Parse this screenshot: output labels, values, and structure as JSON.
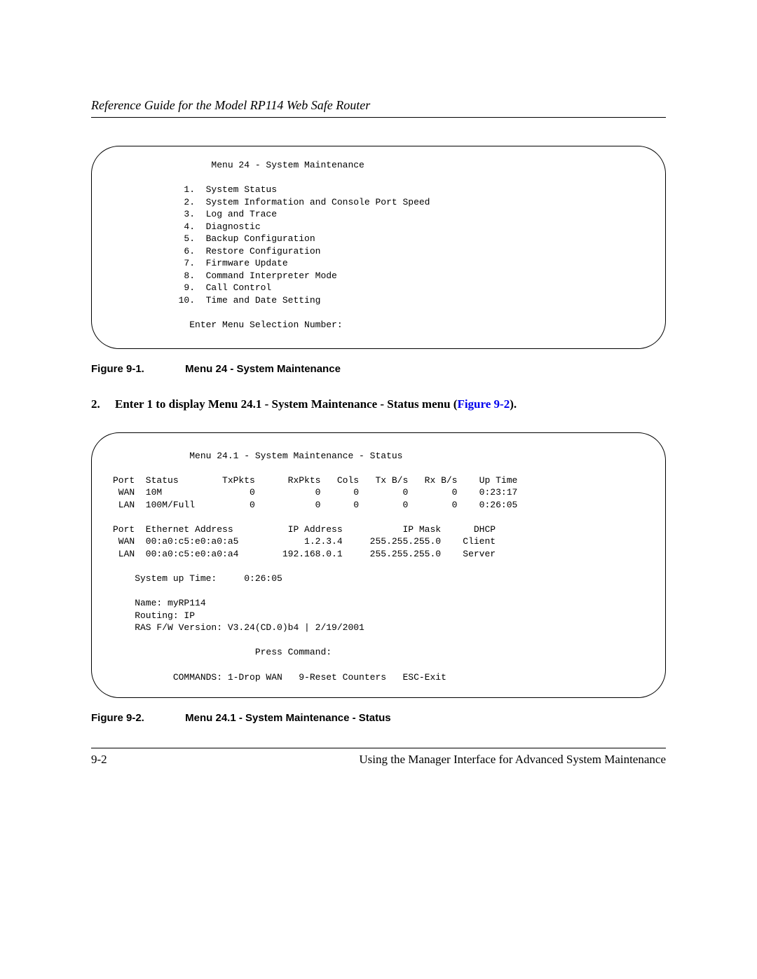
{
  "header": "Reference Guide for the Model RP114 Web Safe Router",
  "menu24": {
    "title": "Menu 24 - System Maintenance",
    "items": [
      "System Status",
      "System Information and Console Port Speed",
      "Log and Trace",
      "Diagnostic",
      "Backup Configuration",
      "Restore Configuration",
      "Firmware Update",
      "Command Interpreter Mode",
      "Call Control",
      "Time and Date Setting"
    ],
    "prompt": "Enter Menu Selection Number:"
  },
  "fig1": {
    "label": "Figure 9-1.",
    "text": "Menu 24 - System Maintenance"
  },
  "step2": {
    "num": "2.",
    "pre": "Enter 1 to display Menu 24.1 - System Maintenance - Status menu (",
    "link": "Figure 9-2",
    "post": ")."
  },
  "menu241": {
    "title": "Menu 24.1 - System Maintenance - Status",
    "ports_cols": [
      "Port",
      "Status",
      "TxPkts",
      "RxPkts",
      "Cols",
      "Tx B/s",
      "Rx B/s",
      "Up Time"
    ],
    "ports": [
      {
        "port": "WAN",
        "status": "10M",
        "tx": "0",
        "rx": "0",
        "cols": "0",
        "txbs": "0",
        "rxbs": "0",
        "up": "0:23:17"
      },
      {
        "port": "LAN",
        "status": "100M/Full",
        "tx": "0",
        "rx": "0",
        "cols": "0",
        "txbs": "0",
        "rxbs": "0",
        "up": "0:26:05"
      }
    ],
    "eth_cols": [
      "Port",
      "Ethernet Address",
      "IP Address",
      "IP Mask",
      "DHCP"
    ],
    "eth": [
      {
        "port": "WAN",
        "mac": "00:a0:c5:e0:a0:a5",
        "ip": "1.2.3.4",
        "mask": "255.255.255.0",
        "dhcp": "Client"
      },
      {
        "port": "LAN",
        "mac": "00:a0:c5:e0:a0:a4",
        "ip": "192.168.0.1",
        "mask": "255.255.255.0",
        "dhcp": "Server"
      }
    ],
    "sys_up": "System up Time:     0:26:05",
    "name": "Name: myRP114",
    "routing": "Routing: IP",
    "fw": "RAS F/W Version: V3.24(CD.0)b4 | 2/19/2001",
    "press": "Press Command:",
    "cmds": "COMMANDS: 1-Drop WAN   9-Reset Counters   ESC-Exit"
  },
  "fig2": {
    "label": "Figure 9-2.",
    "text": "Menu 24.1 - System Maintenance - Status"
  },
  "footer": {
    "left": "9-2",
    "right": "Using the Manager Interface for Advanced System Maintenance"
  }
}
